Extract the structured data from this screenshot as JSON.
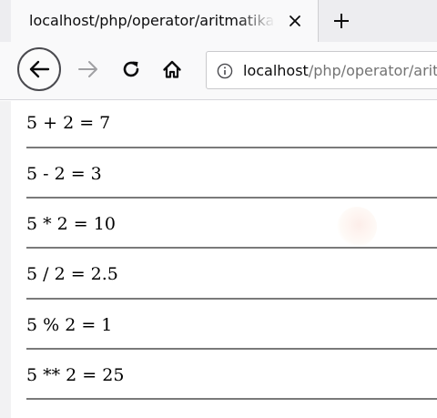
{
  "tab": {
    "title": "localhost/php/operator/aritmatika.php"
  },
  "address_bar": {
    "host": "localhost",
    "path": "/php/operator/aritmatika.php"
  },
  "results": [
    {
      "text": "5 + 2 = 7"
    },
    {
      "text": "5 - 2 = 3"
    },
    {
      "text": "5 * 2 = 10"
    },
    {
      "text": "5 / 2 = 2.5"
    },
    {
      "text": "5 % 2 = 1"
    },
    {
      "text": "5 ** 2 = 25"
    }
  ],
  "icons": {
    "tab_close": "close-icon",
    "new_tab": "plus-icon",
    "back": "arrow-left-icon",
    "forward": "arrow-right-icon",
    "reload": "reload-icon",
    "home": "home-icon",
    "site_info": "info-icon"
  },
  "colors": {
    "tab_strip": "#ededf0",
    "toolbar": "#f9f9fa",
    "text": "#000000",
    "divider": "#7a7a7a",
    "url_path": "#737373"
  }
}
